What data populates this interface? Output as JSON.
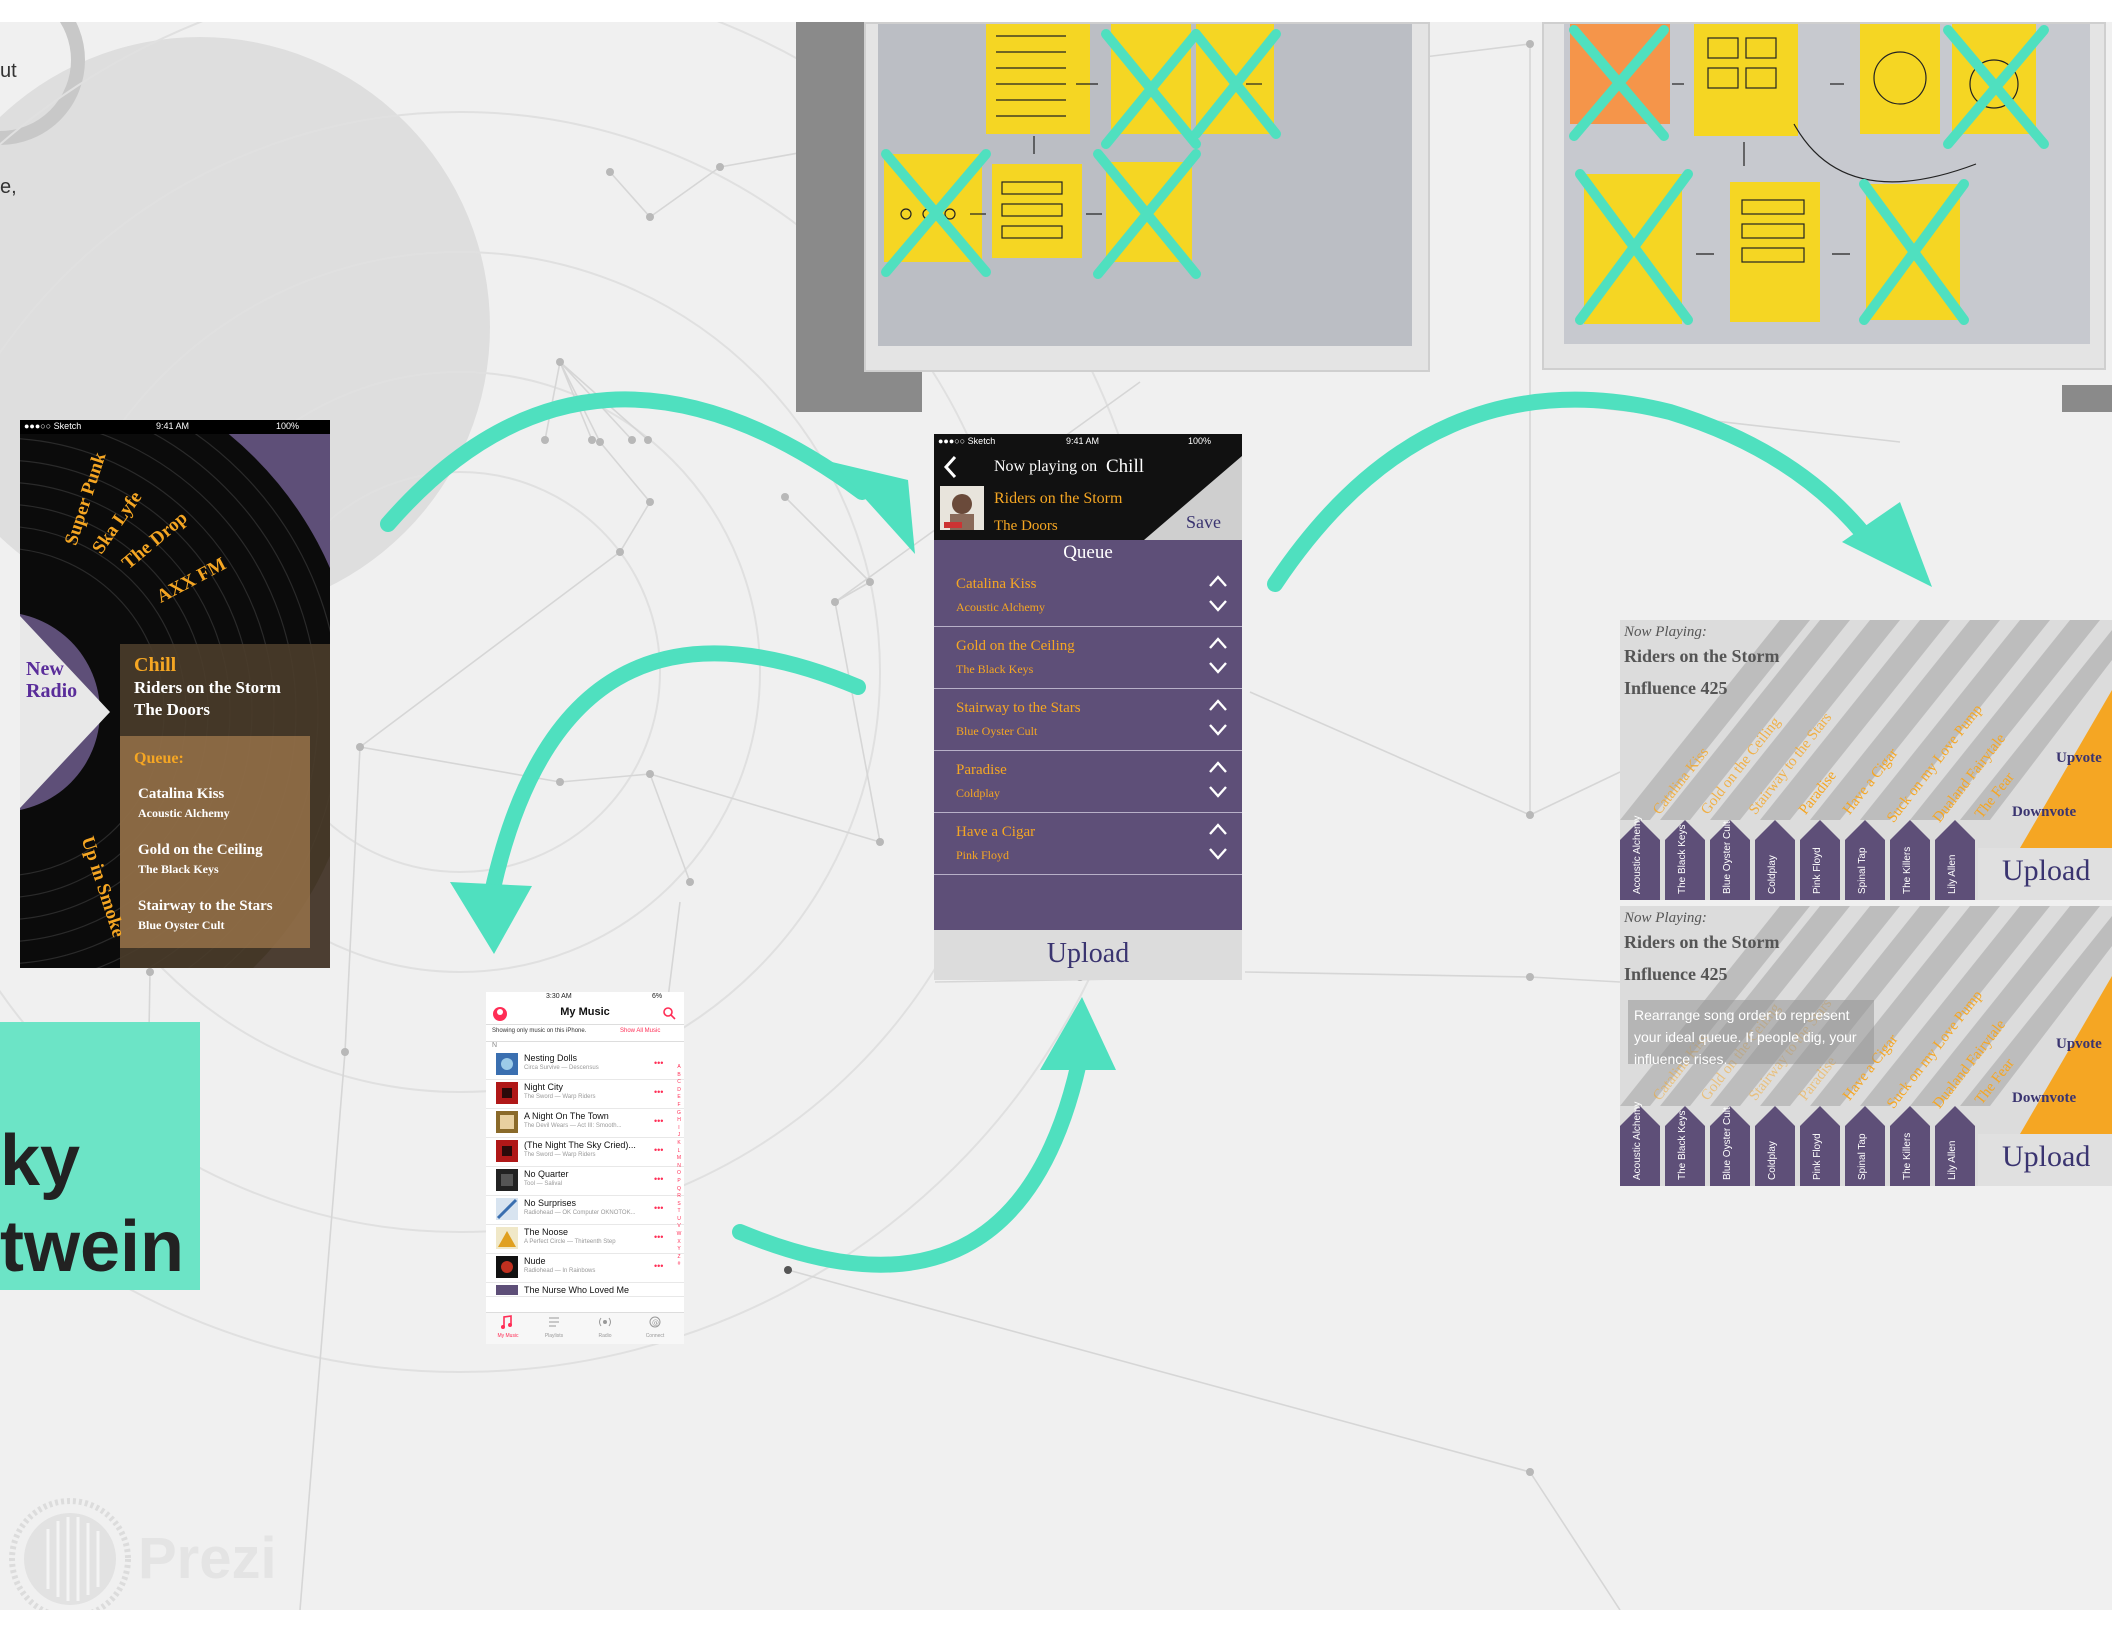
{
  "left_text_fragments": [
    "ut",
    "e,"
  ],
  "title_card": {
    "line1": "ky",
    "line2": "twein"
  },
  "radio_phone": {
    "status_carrier": "●●●○○ Sketch",
    "status_time": "9:41 AM",
    "status_battery": "100%",
    "stations": [
      "Super Punk",
      "Ska Lyfe",
      "The Drop",
      "AXX FM",
      "Up in Smoke"
    ],
    "new_radio": "New Radio",
    "current_station": "Chill",
    "current_song": "Riders on the Storm",
    "current_artist": "The Doors",
    "queue_label": "Queue:",
    "queue": [
      {
        "title": "Catalina Kiss",
        "artist": "Acoustic Alchemy"
      },
      {
        "title": "Gold on the Ceiling",
        "artist": "The Black Keys"
      },
      {
        "title": "Stairway to the Stars",
        "artist": "Blue Oyster Cult"
      }
    ]
  },
  "queue_phone": {
    "status_carrier": "●●●○○ Sketch",
    "status_time": "9:41 AM",
    "status_battery": "100%",
    "now_playing_prefix": "Now playing on",
    "station": "Chill",
    "song": "Riders on the Storm",
    "artist": "The Doors",
    "save_label": "Save",
    "queue_title": "Queue",
    "queue": [
      {
        "title": "Catalina Kiss",
        "artist": "Acoustic Alchemy"
      },
      {
        "title": "Gold on the Ceiling",
        "artist": "The Black Keys"
      },
      {
        "title": "Stairway to the Stars",
        "artist": "Blue Oyster Cult"
      },
      {
        "title": "Paradise",
        "artist": "Coldplay"
      },
      {
        "title": "Have a Cigar",
        "artist": "Pink Floyd"
      }
    ],
    "upload_label": "Upload"
  },
  "influence_panels": [
    {
      "now_playing": "Now Playing:",
      "song": "Riders on the Storm",
      "influence": "Influence 425",
      "diagonal_songs": [
        "Catalina Kiss",
        "Gold on the Ceiling",
        "Stairway to the Stars",
        "Paradise",
        "Have a Cigar",
        "Suck on my Love Pump",
        "Dualand Fairytale",
        "The Fear"
      ],
      "artists": [
        "Acoustic Alchemy",
        "The Black Keys",
        "Blue Oyster Cult",
        "Coldplay",
        "Pink Floyd",
        "Spinal Tap",
        "The Killers",
        "Lily Allen"
      ],
      "upvote": "Upvote",
      "downvote": "Downvote",
      "upload": "Upload"
    },
    {
      "now_playing": "Now Playing:",
      "song": "Riders on the Storm",
      "influence": "Influence 425",
      "diagonal_songs": [
        "Catalina Kiss",
        "Gold on the Ceiling",
        "Stairway to the Stars",
        "Paradise",
        "Have a Cigar",
        "Suck on my Love Pump",
        "Dualand Fairytale",
        "The Fear"
      ],
      "artists": [
        "Acoustic Alchemy",
        "The Black Keys",
        "Blue Oyster Cult",
        "Coldplay",
        "Pink Floyd",
        "Spinal Tap",
        "The Killers",
        "Lily Allen"
      ],
      "upvote": "Upvote",
      "downvote": "Downvote",
      "upload": "Upload",
      "tooltip": "Rearrange song order to represent your ideal queue. If people dig, your influence rises."
    }
  ],
  "my_music_phone": {
    "status_time": "3:30 AM",
    "status_battery": "6%",
    "title": "My Music",
    "filter_text": "Showing only music on this iPhone.",
    "filter_link": "Show All Music",
    "section_letter": "N",
    "songs": [
      {
        "title": "Nesting Dolls",
        "subtitle": "Circa Survive — Descensus"
      },
      {
        "title": "Night City",
        "subtitle": "The Sword — Warp Riders"
      },
      {
        "title": "A Night On The Town",
        "subtitle": "The Devil Wears — Act III: Smooth..."
      },
      {
        "title": "(The Night The Sky Cried)...",
        "subtitle": "The Sword — Warp Riders"
      },
      {
        "title": "No Quarter",
        "subtitle": "Tool — Salival"
      },
      {
        "title": "No Surprises",
        "subtitle": "Radiohead — OK Computer OKNOTOK..."
      },
      {
        "title": "The Noose",
        "subtitle": "A Perfect Circle — Thirteenth Step"
      },
      {
        "title": "Nude",
        "subtitle": "Radiohead — In Rainbows"
      },
      {
        "title": "The Nurse Who Loved Me",
        "subtitle": ""
      }
    ],
    "index_letters": [
      "A",
      "B",
      "C",
      "D",
      "E",
      "F",
      "G",
      "H",
      "I",
      "J",
      "K",
      "L",
      "M",
      "N",
      "O",
      "P",
      "Q",
      "R",
      "S",
      "T",
      "U",
      "V",
      "W",
      "X",
      "Y",
      "Z",
      "#"
    ],
    "tabs": [
      "My Music",
      "Playlists",
      "Radio",
      "Connect"
    ]
  },
  "branding": {
    "logo_text": "Prezi"
  },
  "colors": {
    "teal": "#4fe0bf",
    "purple": "#5e4f78",
    "orange": "#f5a623",
    "sticky_yellow": "#f5d623",
    "canvas": "#f0f0f0"
  }
}
